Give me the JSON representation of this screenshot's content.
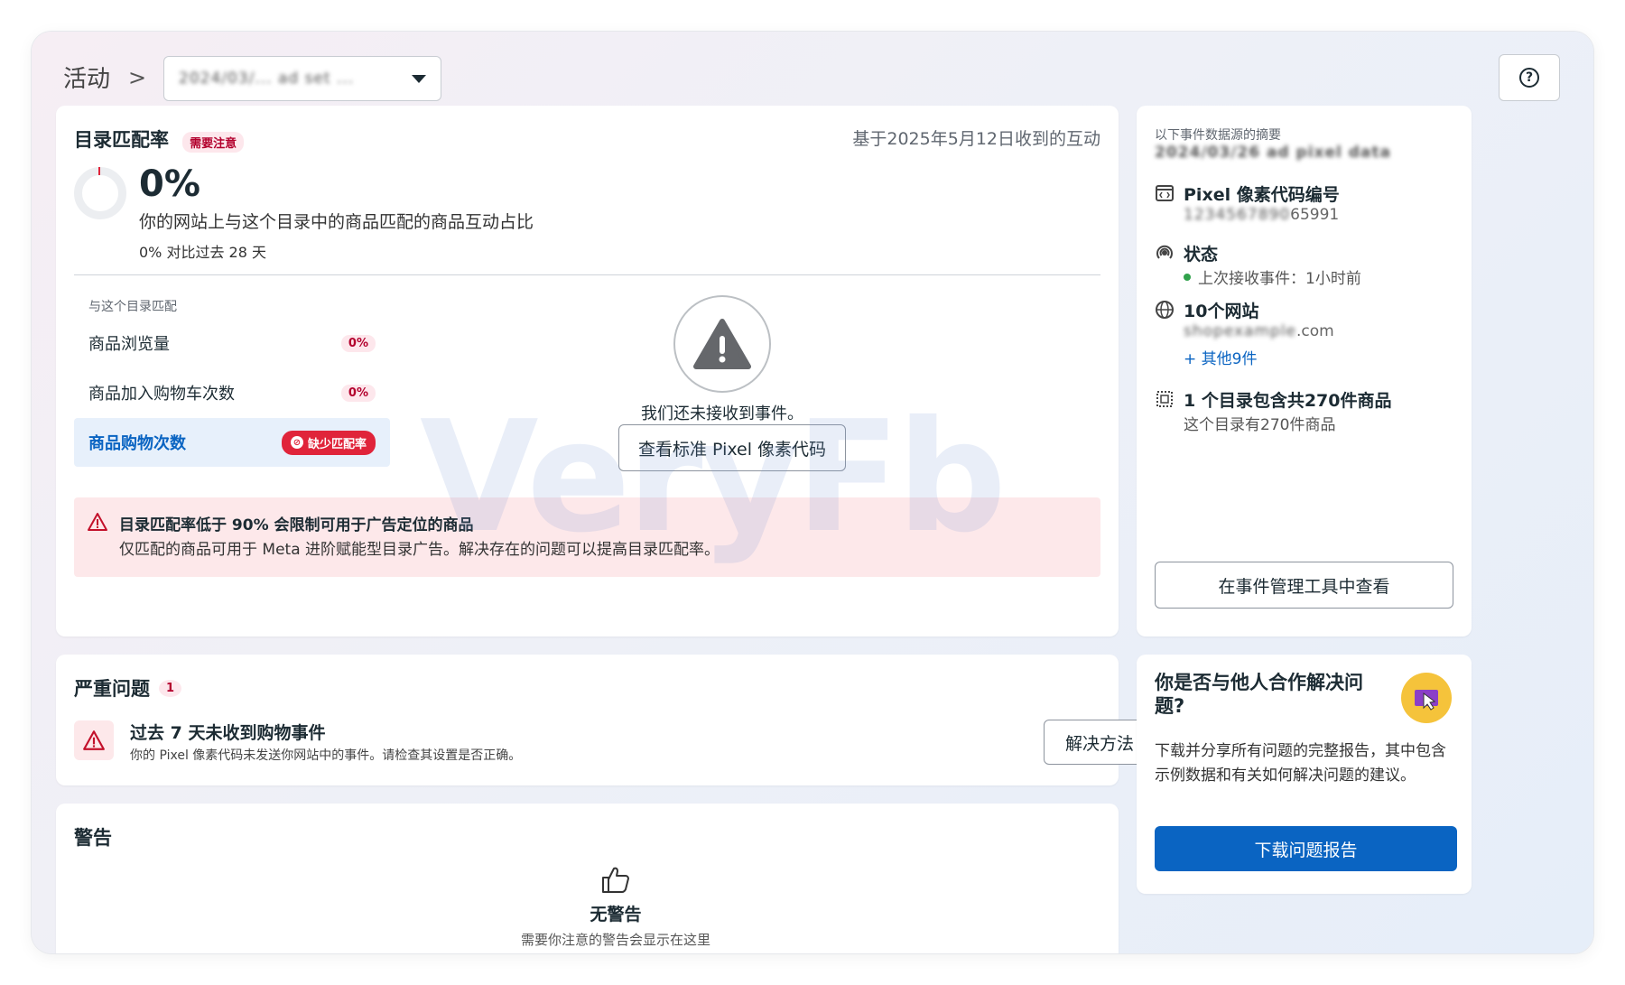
{
  "header": {
    "breadcrumb_label": "活动",
    "breadcrumb_chevron": ">",
    "dropdown_value": "2024/03/... ad set ...",
    "help_icon": "help-circle-icon"
  },
  "match_card": {
    "title": "目录匹配率",
    "attention_badge": "需要注意",
    "based_on": "基于2025年5月12日收到的互动",
    "percent": "0%",
    "percent_value": 0,
    "description": "你的网站上与这个目录中的商品匹配的商品互动占比",
    "compare": "0% 对比过去 28 天",
    "section_label": "与这个目录匹配",
    "metrics": [
      {
        "label": "商品浏览量",
        "badge": "0%"
      },
      {
        "label": "商品加入购物车次数",
        "badge": "0%"
      },
      {
        "label": "商品购物次数",
        "badge": "缺少匹配率"
      }
    ],
    "no_events_text": "我们还未接收到事件。",
    "view_pixel_button": "查看标准 Pixel 像素代码",
    "alert_title": "目录匹配率低于 90% 会限制可用于广告定位的商品",
    "alert_body": "仅匹配的商品可用于 Meta 进阶赋能型目录广告。解决存在的问题可以提高目录匹配率。",
    "watermark": "VeryFb"
  },
  "summary_card": {
    "label": "以下事件数据源的摘要",
    "source_name": "2024/03/26 ad pixel data",
    "pixel_title": "Pixel 像素代码编号",
    "pixel_id_hidden": "1234567890",
    "pixel_id_visible": "65991",
    "status_title": "状态",
    "status_text": "上次接收事件：1小时前",
    "status_color": "#31a24c",
    "sites_title": "10个网站",
    "site_hidden": "shopexample",
    "site_visible": ".com",
    "more_sites": "+ 其他9件",
    "catalog_title": "1 个目录包含共270件商品",
    "catalog_sub": "这个目录有270件商品",
    "events_manager_button": "在事件管理工具中查看"
  },
  "issues_card": {
    "title": "严重问题",
    "count": "1",
    "issue_title": "过去 7 天未收到购物事件",
    "issue_desc": "你的 Pixel 像素代码未发送你网站中的事件。请检查其设置是否正确。",
    "fix_button": "解决方法"
  },
  "collab_card": {
    "title": "你是否与他人合作解决问题?",
    "body": "下载并分享所有问题的完整报告，其中包含示例数据和有关如何解决问题的建议。",
    "download_button": "下载问题报告"
  },
  "warnings_card": {
    "title": "警告",
    "empty_title": "无警告",
    "empty_sub": "需要你注意的警告会显示在这里"
  },
  "colors": {
    "primary": "#0a64c2",
    "danger": "#e0243a",
    "alert_bg": "#fde8ea"
  }
}
